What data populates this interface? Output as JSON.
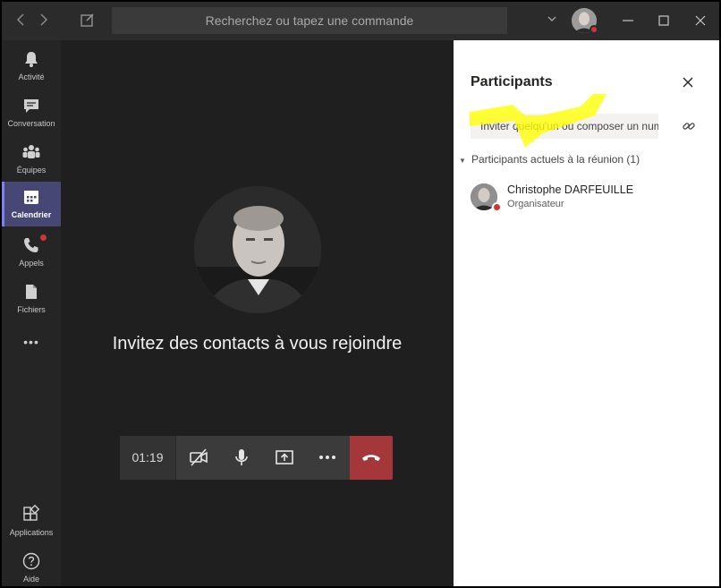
{
  "titlebar": {
    "search_placeholder": "Recherchez ou tapez une commande",
    "back_icon": "chevron-left-icon",
    "forward_icon": "chevron-right-icon",
    "compose_icon": "compose-icon"
  },
  "rail": {
    "items": [
      {
        "label": "Activité",
        "icon": "bell-icon"
      },
      {
        "label": "Conversation",
        "icon": "chat-icon"
      },
      {
        "label": "Équipes",
        "icon": "teams-icon"
      },
      {
        "label": "Calendrier",
        "icon": "calendar-icon",
        "active": true
      },
      {
        "label": "Appels",
        "icon": "phone-icon",
        "badge": true
      },
      {
        "label": "Fichiers",
        "icon": "file-icon"
      }
    ],
    "more": "•••",
    "apps_label": "Applications",
    "help_label": "Aide"
  },
  "stage": {
    "invite_text": "Invitez des contacts à vous rejoindre",
    "timer": "01:19"
  },
  "panel": {
    "title": "Participants",
    "invite_placeholder": "Inviter quelqu'un ou composer un numéro",
    "section_label": "Participants actuels à la réunion (1)",
    "participants": [
      {
        "name": "Christophe DARFEUILLE",
        "role": "Organisateur",
        "status": "busy"
      }
    ]
  },
  "colors": {
    "accent": "#464775",
    "hangup": "#a4373a",
    "status_busy": "#d13438",
    "highlight": "#ffff00"
  }
}
